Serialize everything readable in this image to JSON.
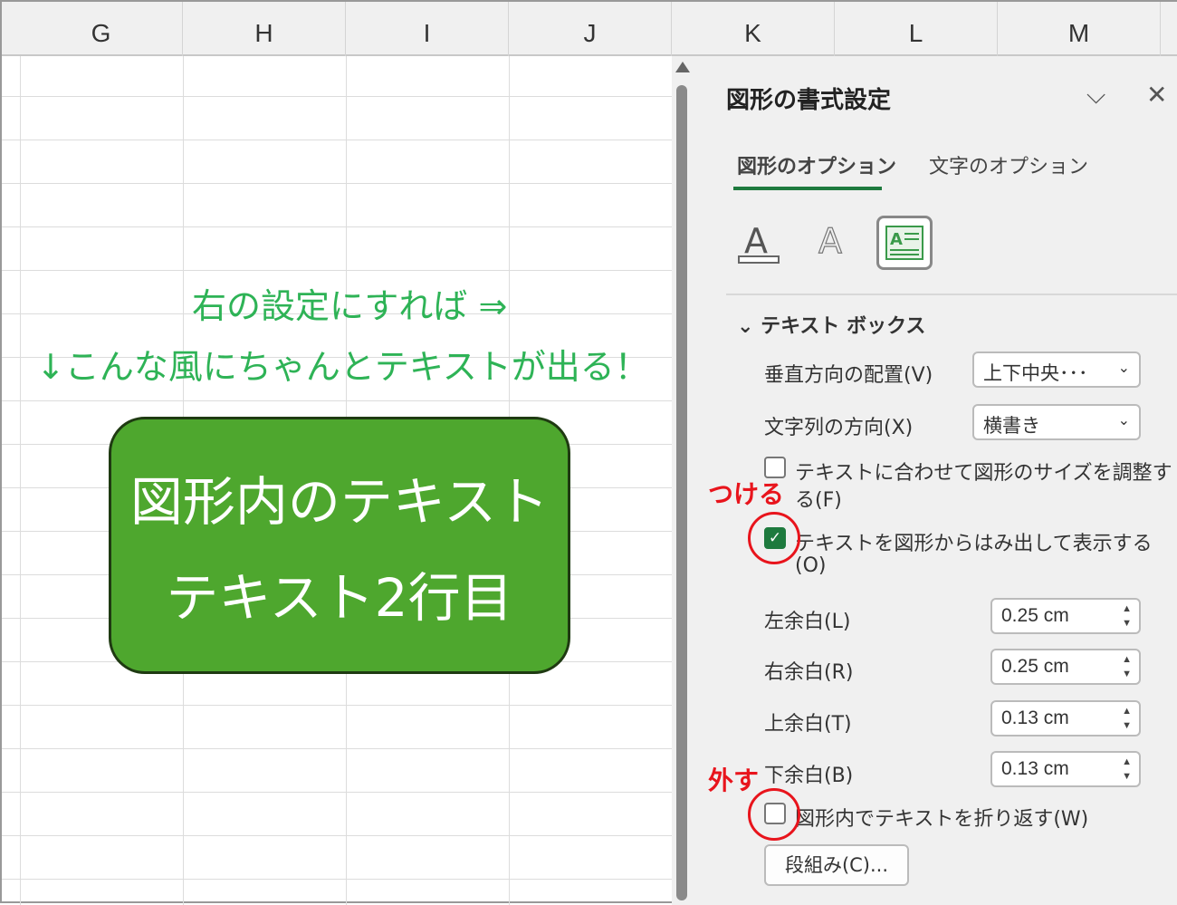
{
  "columns": [
    "G",
    "H",
    "I",
    "J",
    "K",
    "L",
    "M"
  ],
  "sheet": {
    "note_line1": "右の設定にすれば ⇒",
    "note_line2": "↓こんな風にちゃんとテキストが出る！",
    "shape_line1": "図形内のテキスト",
    "shape_line2": "テキスト2行目"
  },
  "panel": {
    "title": "図形の書式設定",
    "tabs": [
      {
        "label": "図形のオプション",
        "active": true
      },
      {
        "label": "文字のオプション",
        "active": false
      }
    ],
    "section": "テキスト ボックス",
    "vertical_align": {
      "label": "垂直方向の配置(V)",
      "value": "上下中央･･･"
    },
    "text_direction": {
      "label": "文字列の方向(X)",
      "value": "横書き"
    },
    "autofit": {
      "label_1": "テキストに合わせて図形のサイズを調整す",
      "label_2": "る(F)",
      "checked": false
    },
    "overflow": {
      "label_1": "テキストを図形からはみ出して表示する",
      "label_2": "(O)",
      "checked": true
    },
    "margins": [
      {
        "label": "左余白(L)",
        "value": "0.25 cm"
      },
      {
        "label": "右余白(R)",
        "value": "0.25 cm"
      },
      {
        "label": "上余白(T)",
        "value": "0.13 cm"
      },
      {
        "label": "下余白(B)",
        "value": "0.13 cm"
      }
    ],
    "wrap": {
      "label": "図形内でテキストを折り返す(W)",
      "checked": false
    },
    "columns_button": "段組み(C)..."
  },
  "annotations": {
    "attach": "つける",
    "remove": "外す"
  },
  "colors": {
    "accent": "#1e7a3e",
    "shape": "#4ea72e",
    "note": "#2eb356",
    "annotation": "#e8141c"
  }
}
